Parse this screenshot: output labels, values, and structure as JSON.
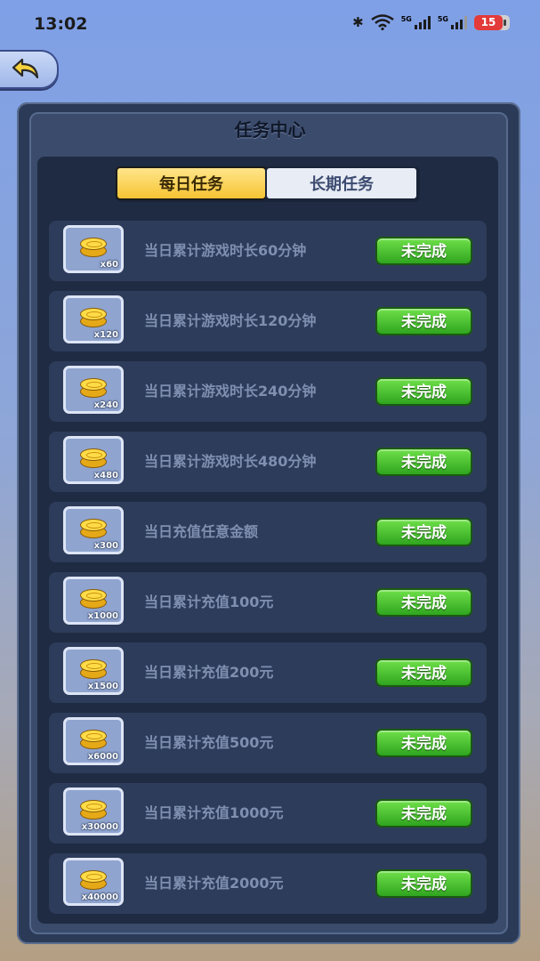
{
  "status_bar": {
    "time": "13:02",
    "network_1": "5G",
    "network_2": "5G",
    "battery": "15",
    "icons": [
      "bluetooth-icon",
      "wifi-icon",
      "signal-icon",
      "signal-icon",
      "battery-icon"
    ]
  },
  "back_button": {
    "icon": "back-arrow-icon"
  },
  "panel": {
    "title": "任务中心",
    "tabs": [
      {
        "label": "每日任务",
        "active": true
      },
      {
        "label": "长期任务",
        "active": false
      }
    ]
  },
  "tasks": [
    {
      "reward": "x60",
      "name": "当日累计游戏时长60分钟",
      "status": "未完成"
    },
    {
      "reward": "x120",
      "name": "当日累计游戏时长120分钟",
      "status": "未完成"
    },
    {
      "reward": "x240",
      "name": "当日累计游戏时长240分钟",
      "status": "未完成"
    },
    {
      "reward": "x480",
      "name": "当日累计游戏时长480分钟",
      "status": "未完成"
    },
    {
      "reward": "x300",
      "name": "当日充值任意金额",
      "status": "未完成"
    },
    {
      "reward": "x1000",
      "name": "当日累计充值100元",
      "status": "未完成"
    },
    {
      "reward": "x1500",
      "name": "当日累计充值200元",
      "status": "未完成"
    },
    {
      "reward": "x6000",
      "name": "当日累计充值500元",
      "status": "未完成"
    },
    {
      "reward": "x30000",
      "name": "当日累计充值1000元",
      "status": "未完成"
    },
    {
      "reward": "x40000",
      "name": "当日累计充值2000元",
      "status": "未完成"
    }
  ],
  "colors": {
    "accent_green": "#2fa51f",
    "tab_active": "#f6c433",
    "panel_bg": "#1f2b42"
  }
}
